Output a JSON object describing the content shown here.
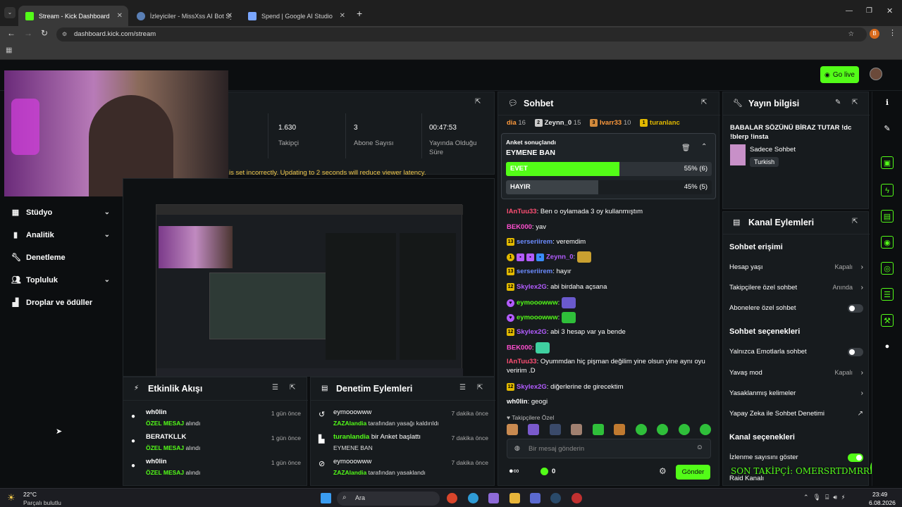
{
  "browser": {
    "tabs": [
      {
        "label": "Stream - Kick Dashboard",
        "active": true
      },
      {
        "label": "İzleyiciler - MissXss AI Bot Syste"
      },
      {
        "label": "Spend | Google AI Studio"
      }
    ],
    "url": "dashboard.kick.com/stream",
    "profile_initial": "B"
  },
  "top": {
    "go_live_label": "Go live"
  },
  "stats": {
    "followers_value": "1.630",
    "followers_label": "Takipçi",
    "subs_value": "3",
    "subs_label": "Abone Sayısı",
    "uptime_value": "00:47:53",
    "uptime_label_1": "Yayında Olduğu",
    "uptime_label_2": "Süre",
    "warning": "is set incorrectly. Updating to 2 seconds will reduce viewer latency."
  },
  "sidebar": {
    "items": [
      {
        "label": "Stüdyo"
      },
      {
        "label": "Analitik"
      },
      {
        "label": "Denetleme"
      },
      {
        "label": "Topluluk"
      },
      {
        "label": "Droplar ve ödüller"
      }
    ]
  },
  "activity": {
    "title": "Etkinlik Akışı",
    "rows": [
      {
        "name": "wh0lin",
        "type": "ÖZEL MESAJ",
        "suffix": "alındı",
        "time": "1 gün önce"
      },
      {
        "name": "BERATKLLK",
        "type": "ÖZEL MESAJ",
        "suffix": "alındı",
        "time": "1 gün önce"
      },
      {
        "name": "wh0lin",
        "type": "ÖZEL MESAJ",
        "suffix": "alındı",
        "time": "1 gün önce"
      }
    ]
  },
  "moderation": {
    "title": "Denetim Eylemleri",
    "rows": [
      {
        "name": "eymooowww",
        "actor": "ZAZAlandia",
        "text": "tarafından yasağı kaldırıldı",
        "time": "7 dakika önce"
      },
      {
        "name": "turanlandia",
        "name_suffix": " bir Anket başlattı",
        "text2": "EYMENE BAN",
        "time": "7 dakika önce"
      },
      {
        "name": "eymooowww",
        "actor": "ZAZAlandia",
        "text": "tarafından yasaklandı",
        "time": "7 dakika önce"
      }
    ]
  },
  "chat": {
    "title": "Sohbet",
    "leaders": [
      {
        "name": "dia",
        "count": "16"
      },
      {
        "name": "Zeynn_0",
        "count": "15"
      },
      {
        "name": "Ivarr33",
        "count": "10"
      },
      {
        "name": "turanlanc",
        "count": ""
      }
    ],
    "poll": {
      "header": "Anket sonuçlandı",
      "question": "EYMENE BAN",
      "options": [
        {
          "label": "EVET",
          "result": "55% (6)",
          "fraction": 0.55
        },
        {
          "label": "HAYIR",
          "result": "45% (5)",
          "fraction": 0.45
        }
      ]
    },
    "messages": [
      {
        "user": "lAnTuu33",
        "text": ": Ben o oylamada 3 oy kullanmıştım"
      },
      {
        "user": "BEK000",
        "text": ": yav"
      },
      {
        "badge": "13",
        "user": "serseriirem",
        "text": ": veremdim"
      },
      {
        "user": "Zeynn_0",
        "text": ":"
      },
      {
        "badge": "13",
        "user": "serseriirem",
        "text": ": hayır"
      },
      {
        "badge": "12",
        "user": "Skylex2G",
        "text": ": abi birdaha açsana"
      },
      {
        "user": "eymooowww",
        "text": ":"
      },
      {
        "user": "eymooowww",
        "text": ":"
      },
      {
        "badge": "12",
        "user": "Skylex2G",
        "text": ": abi 3 hesap var ya bende"
      },
      {
        "user": "BEK000",
        "text": ":"
      },
      {
        "user": "lAnTuu33",
        "text": ": Oyummdan hiç pişman değilim yine olsun yine aynı oyu veririm .D"
      },
      {
        "badge": "12",
        "user": "Skylex2G",
        "text": ": diğerlerine de girecektim"
      },
      {
        "user": "wh0lin",
        "text": ": geogi"
      }
    ],
    "followers_only": "Takipçilere Özel",
    "input_placeholder": "Bir mesaj gönderin",
    "points": "0",
    "send_label": "Gönder"
  },
  "stream_info": {
    "title": "Yayın bilgisi",
    "stream_title": "BABALAR SÖZÜNÜ BİRAZ TUTAR !dc !blerp !insta",
    "category": "Sadece Sohbet",
    "language": "Turkish"
  },
  "channel_actions": {
    "title": "Kanal Eylemleri",
    "chat_access": "Sohbet erişimi",
    "account_age": "Hesap yaşı",
    "account_age_val": "Kapalı",
    "followers_chat": "Takipçilere özel sohbet",
    "followers_chat_val": "Anında",
    "subs_chat": "Abonelere özel sohbet",
    "chat_options": "Sohbet seçenekleri",
    "emote_only": "Yalnızca Emotlarla sohbet",
    "slow_mode": "Yavaş mod",
    "slow_mode_val": "Kapalı",
    "banned_words": "Yasaklanmış kelimeler",
    "ai_mod": "Yapay Zeka ile Sohbet Denetimi",
    "channel_options": "Kanal seçenekleri",
    "show_viewers": "İzlenme sayısını göster",
    "raid": "Raid Kanalı",
    "overlay": "SON TAKİPÇİ: OMERSRTDMRRR"
  },
  "taskbar": {
    "temp": "22°C",
    "weather": "Parçalı bulutlu",
    "search": "Ara",
    "time": "23:49",
    "date": "6.08.2026"
  }
}
